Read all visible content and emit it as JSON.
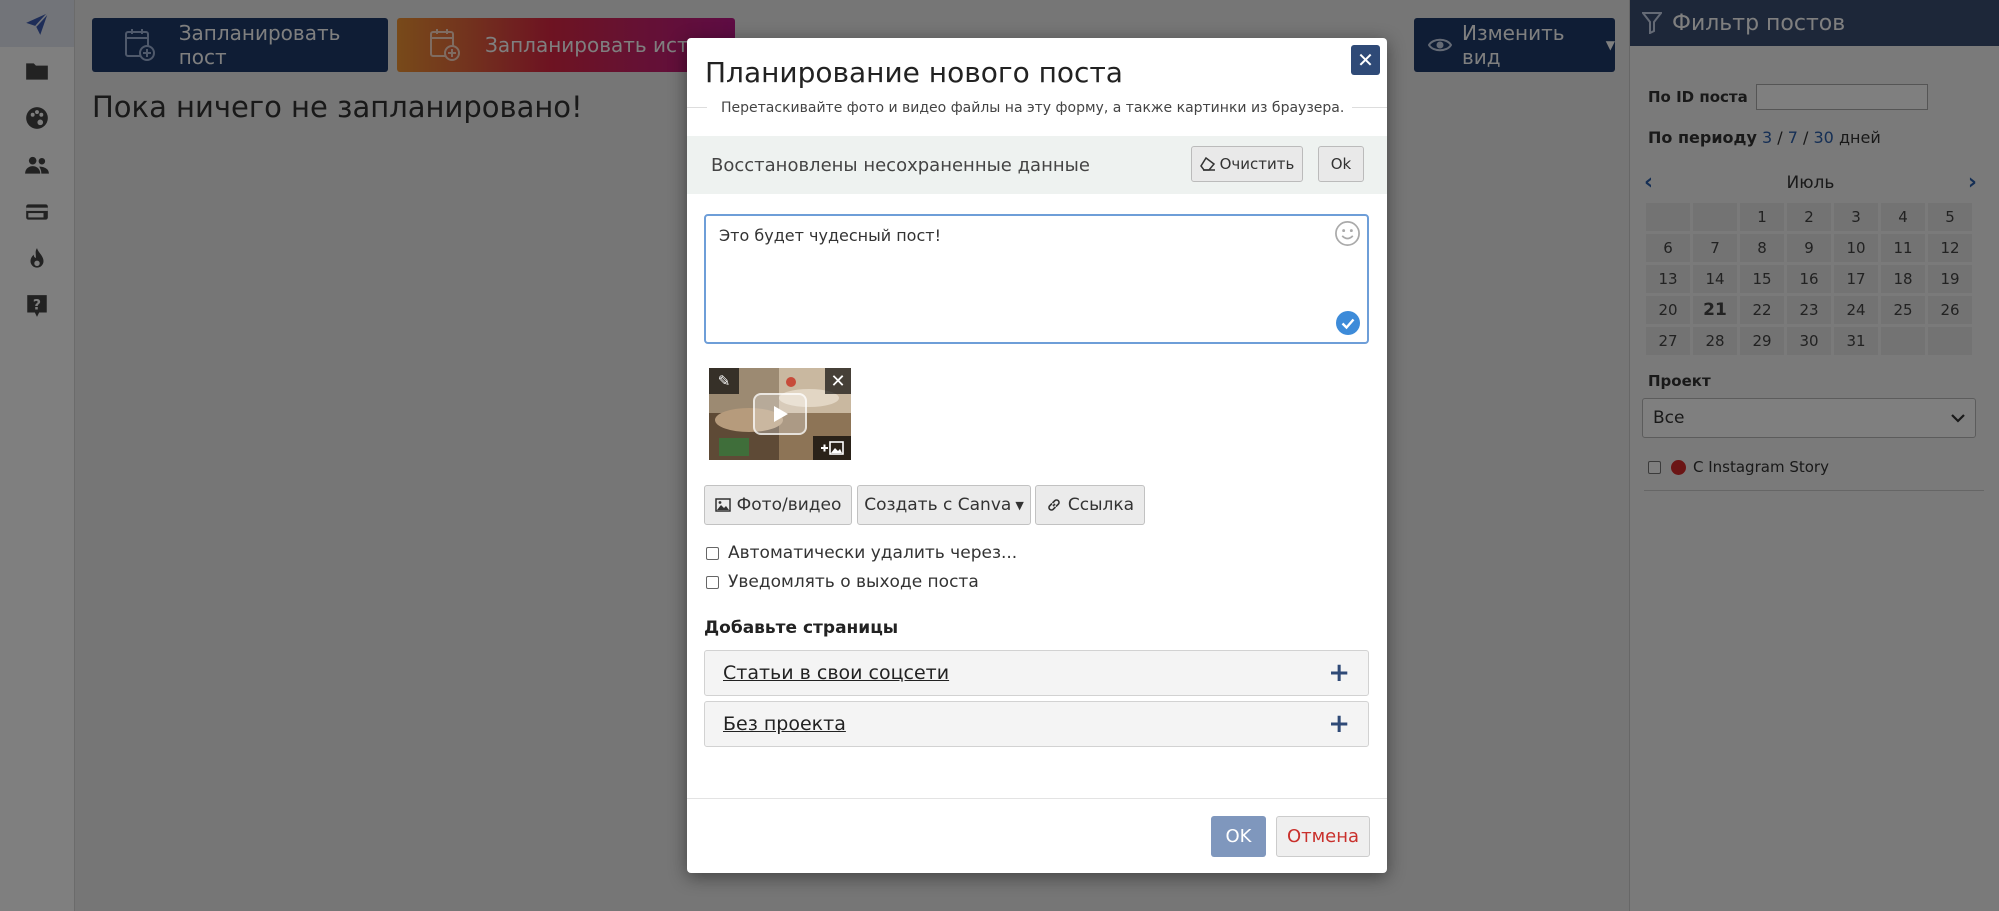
{
  "sidebar": {
    "items": [
      {
        "icon": "paper-plane-icon",
        "active": true
      },
      {
        "icon": "folder-icon"
      },
      {
        "icon": "palette-icon"
      },
      {
        "icon": "users-icon"
      },
      {
        "icon": "credit-card-icon"
      },
      {
        "icon": "fire-icon"
      },
      {
        "icon": "help-icon"
      }
    ]
  },
  "main": {
    "schedule_post_label": "Запланировать пост",
    "schedule_story_label": "Запланировать истори",
    "change_view_label": "Изменить вид",
    "empty_message": "Пока ничего не запланировано!"
  },
  "filter": {
    "title": "Фильтр постов",
    "by_id_label": "По ID поста",
    "period_label": "По периоду",
    "period_3": "3",
    "period_7": "7",
    "period_30": "30",
    "period_sep": "/",
    "period_days": "дней",
    "month": "Июль",
    "calendar_days": [
      "",
      "",
      "1",
      "2",
      "3",
      "4",
      "5",
      "6",
      "7",
      "8",
      "9",
      "10",
      "11",
      "12",
      "13",
      "14",
      "15",
      "16",
      "17",
      "18",
      "19",
      "20",
      "21",
      "22",
      "23",
      "24",
      "25",
      "26",
      "27",
      "28",
      "29",
      "30",
      "31",
      "",
      ""
    ],
    "today": "21",
    "project_label": "Проект",
    "project_value": "Все",
    "instagram_story_label": "С Instagram Story"
  },
  "modal": {
    "title": "Планирование нового поста",
    "hint": "Перетаскивайте фото и видео файлы на эту форму, а также картинки из браузера.",
    "restored_text": "Восстановлены несохраненные данные",
    "clear_label": "Очистить",
    "ok_small_label": "Ok",
    "post_text": "Это будет чудесный пост!",
    "photo_video_label": "Фото/видео",
    "canva_label": "Создать с Canva",
    "link_label": "Ссылка",
    "auto_delete_label": "Автоматически удалить через...",
    "notify_label": "Уведомлять о выходе поста",
    "pages_label": "Добавьте страницы",
    "accordion": [
      "Статьи в свои соцсети",
      "Без проекта"
    ],
    "ok_label": "OK",
    "cancel_label": "Отмена"
  },
  "colors": {
    "brand_dark": "#1f3b6b",
    "accent_blue": "#2b5eaa",
    "cancel_red": "#c9302c"
  }
}
